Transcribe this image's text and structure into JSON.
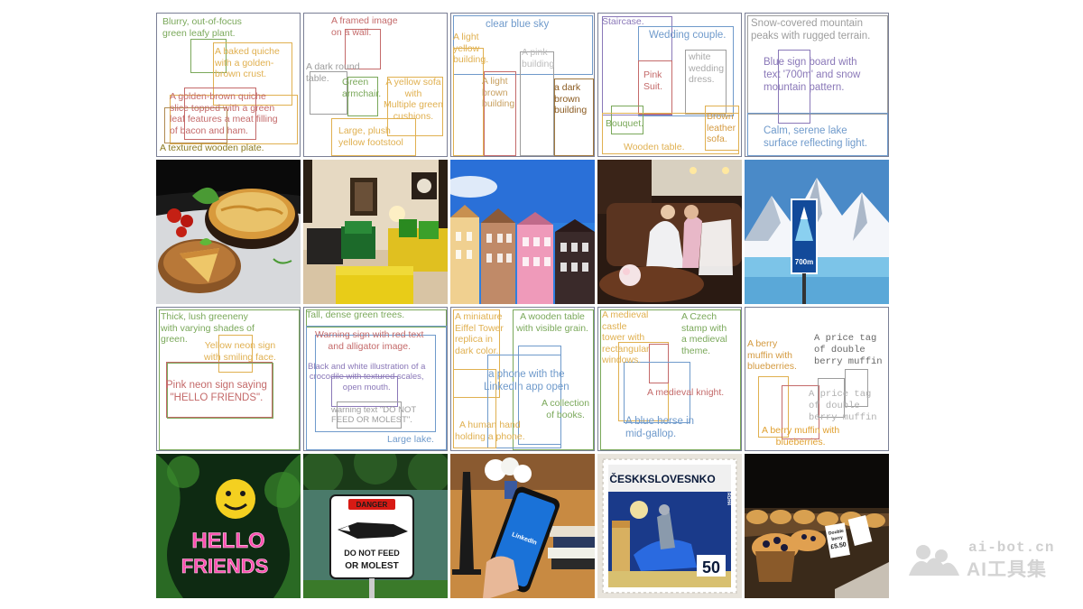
{
  "layout_panels": [
    {
      "labels": [
        "Blurry, out-of-focus\ngreen leafy plant.",
        "A baked quiche\nwith a golden-\nbrown crust.",
        "A golden-brown quiche\nslice topped with a green\nleaf features a meat filling\nof bacon and ham.",
        "A textured wooden plate."
      ]
    },
    {
      "labels": [
        "A framed image\non a wall.",
        "A dark round\ntable.",
        "Green\narmchair.",
        "A yellow sofa\nwith\nMultiple green\ncushions.",
        "Large, plush\nyellow footstool"
      ]
    },
    {
      "labels": [
        "clear blue sky",
        "A light\nyellow\nbuilding.",
        "A pink\nbuilding",
        "A light\nbrown\nbuilding",
        "a dark\nbrown\nbuilding"
      ]
    },
    {
      "labels": [
        "Staircase.",
        "Wedding couple.",
        "white\nwedding\ndress.",
        "Pink\nSuit.",
        "Brown\nleather\nsofa.",
        "Bouquet.",
        "Wooden table."
      ]
    },
    {
      "labels": [
        "Snow-covered mountain\npeaks with rugged terrain.",
        "Blue sign board with\ntext '700m' and snow\nmountain pattern.",
        "Calm, serene lake\nsurface reflecting light."
      ]
    },
    {
      "labels": [
        "Thick, lush greeneny\nwith varying shades of\ngreen.",
        "Yellow neon sign\nwith smiling face.",
        "Pink neon sign saying\n\"HELLO FRIENDS\"."
      ]
    },
    {
      "labels": [
        "Tall, dense green trees.",
        "Warning sign with red text\nand alligator image.",
        "Black and white illustration of a\ncrocodile with textured scales,\nopen mouth.",
        "warning text \"DO NOT\nFEED OR MOLEST\".",
        "Large lake."
      ]
    },
    {
      "labels": [
        "A miniature\nEiffel Tower\nreplica in\ndark color.",
        "A wooden table\nwith visible grain.",
        "a phone with the\nLinkedIn app open",
        "A collection\nof books.",
        "A human hand\nholding a phone."
      ]
    },
    {
      "labels": [
        "A medieval\ncastle\ntower with\nrectangular\nwindows.",
        "A Czech\nstamp with\na medieval\ntheme.",
        "A medieval knight.",
        "A blue horse in\nmid-gallop."
      ]
    },
    {
      "labels": [
        "A berry\nmuffin with\nblueberries.",
        "A price tag\nof double\nberry muffin",
        "A price tag\nof double\nberry muffin",
        "A berry muffin with\nblueberries."
      ]
    }
  ],
  "photo_text": {
    "neon_line1": "HELLO",
    "neon_line2": "FRIENDS",
    "danger": "DANGER",
    "sign_line1": "DO NOT FEED",
    "sign_line2": "OR MOLEST",
    "dist": "700m",
    "app": "LinkedIn",
    "stamp_title": "ČESKKSLOVESNKO",
    "stamp_value": "50",
    "stamp_side": "ROH4",
    "tag_line1": "Double",
    "tag_line2": "berry",
    "tag_price": "£5.50"
  },
  "watermark": {
    "url": "ai-bot.cn",
    "name": "AI工具集"
  },
  "colors": {
    "green": "#7aa85a",
    "orange": "#e0b050",
    "red": "#c46a6a",
    "blue": "#6f9acb",
    "gray": "#9d9d9d",
    "purple": "#8a78b8",
    "brown": "#a07840",
    "olive": "#9a9030",
    "lightgreen": "#9cc87a",
    "frame": "#7a7f95"
  }
}
